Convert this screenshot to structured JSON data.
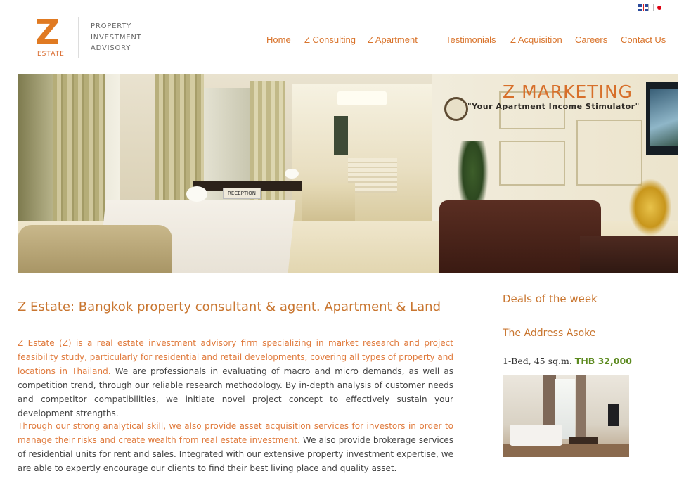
{
  "header": {
    "logo": {
      "letter": "Z",
      "word": "ESTATE"
    },
    "tagline": [
      "PROPERTY",
      "INVESTMENT",
      "ADVISORY"
    ],
    "languages": [
      {
        "icon": "uk-flag-icon",
        "label": "English"
      },
      {
        "icon": "japan-flag-icon",
        "label": "Japanese"
      }
    ]
  },
  "nav": {
    "items": [
      {
        "label": "Home"
      },
      {
        "label": "Z Consulting"
      },
      {
        "label": "Z Apartment"
      },
      {
        "label": "Testimonials"
      },
      {
        "label": "Z Acquisition"
      },
      {
        "label": "Careers"
      },
      {
        "label": "Contact Us"
      }
    ]
  },
  "hero": {
    "title": "Z MARKETING",
    "subtitle": "\"Your Apartment Income Stimulator\"",
    "sign": "RECEPTION"
  },
  "main": {
    "title": "Z Estate: Bangkok property consultant & agent. Apartment & Land",
    "p1_highlight": "Z Estate (Z) is a real estate investment advisory firm specializing in market research and project feasibility study, particularly for residential and retail developments, covering all types of property and locations in Thailand.",
    "p1_rest": " We are professionals in evaluating of macro and micro demands, as well as competition trend, through our reliable research methodology.  By in-depth analysis of customer needs and competitor compatibilities, we initiate novel project concept to effectively sustain your development strengths.",
    "p2_highlight": "Through our strong analytical skill, we also provide asset acquisition services for investors in order to manage their risks and create wealth from real estate investment.",
    "p2_rest": "  We also provide brokerage services of residential units for rent and sales. Integrated with our extensive property investment expertise, we are able to expertly encourage our clients to find their best living place and quality asset."
  },
  "sidebar": {
    "title": "Deals of the week",
    "deal": {
      "name": "The Address Asoke",
      "spec": "1-Bed, 45 sq.m.",
      "price": "THB 32,000"
    }
  },
  "colors": {
    "accent": "#d9742c",
    "price": "#5c8a1f"
  }
}
